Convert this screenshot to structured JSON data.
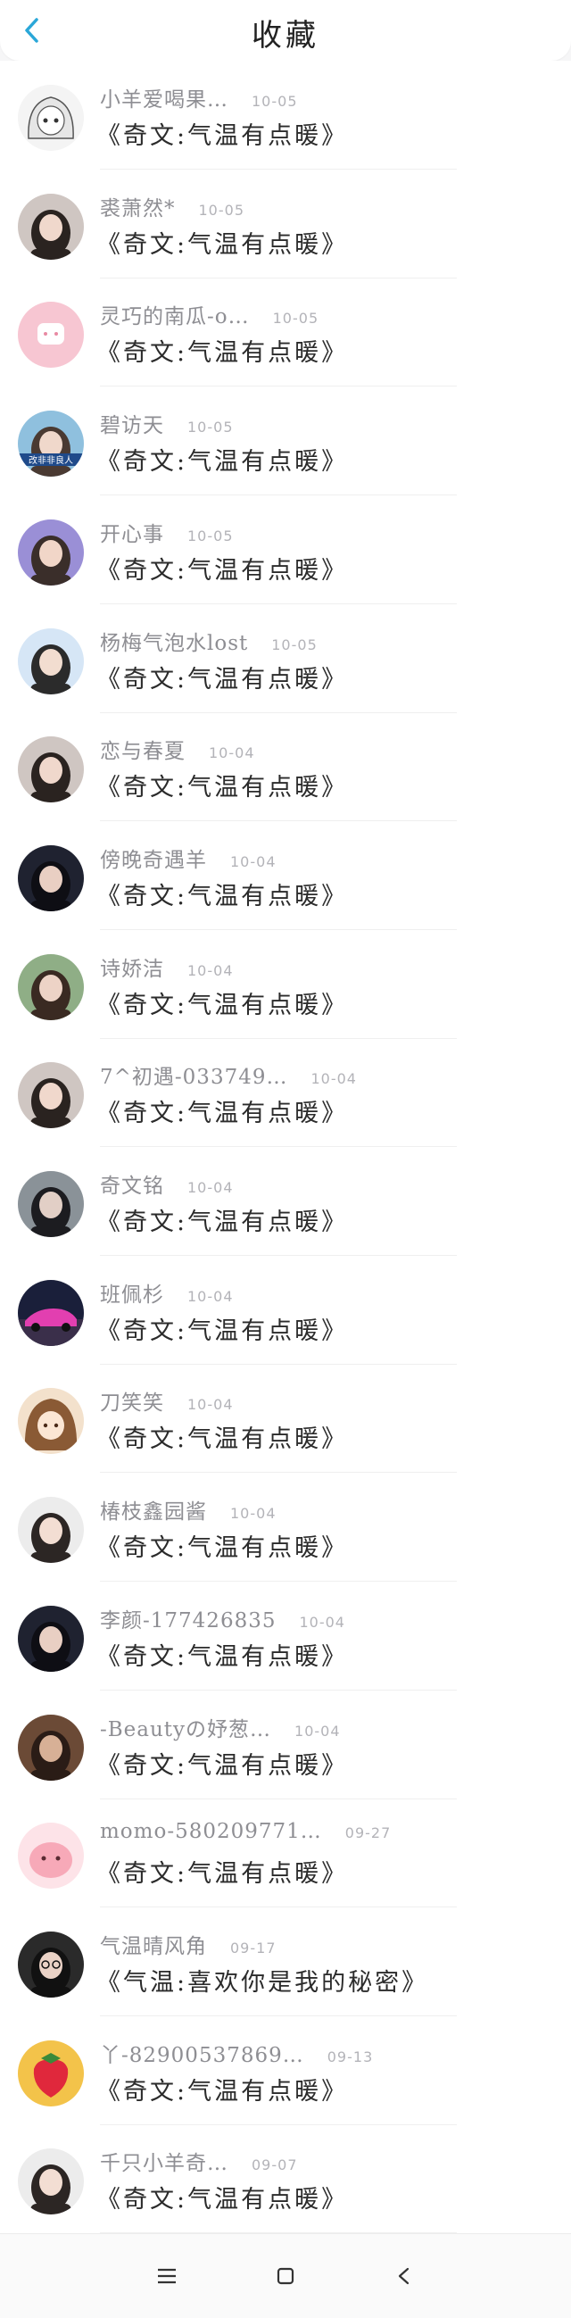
{
  "header": {
    "title": "收藏",
    "back_icon": "chevron-left-icon",
    "accent_color": "#2aa7d8"
  },
  "favorites": [
    {
      "name": "小羊爱喝果…",
      "date": "10-05",
      "message": "《奇文:气温有点暖》",
      "avatar": "anime-girl"
    },
    {
      "name": "裘萧然*",
      "date": "10-05",
      "message": "《奇文:气温有点暖》",
      "avatar": "photo-portrait"
    },
    {
      "name": "灵巧的南瓜-o…",
      "date": "10-05",
      "message": "《奇文:气温有点暖》",
      "avatar": "pink-cartoon"
    },
    {
      "name": "碧访天",
      "date": "10-05",
      "message": "《奇文:气温有点暖》",
      "avatar": "photo-caption",
      "avatar_text": "改非非良人"
    },
    {
      "name": "开心事",
      "date": "10-05",
      "message": "《奇文:气温有点暖》",
      "avatar": "photo-purple"
    },
    {
      "name": "杨梅气泡水lost",
      "date": "10-05",
      "message": "《奇文:气温有点暖》",
      "avatar": "photo-blue"
    },
    {
      "name": "恋与春夏",
      "date": "10-04",
      "message": "《奇文:气温有点暖》",
      "avatar": "photo-portrait"
    },
    {
      "name": "傍晚奇遇羊",
      "date": "10-04",
      "message": "《奇文:气温有点暖》",
      "avatar": "photo-dark"
    },
    {
      "name": "诗娇洁",
      "date": "10-04",
      "message": "《奇文:气温有点暖》",
      "avatar": "photo-green"
    },
    {
      "name": "7^初遇-033749…",
      "date": "10-04",
      "message": "《奇文:气温有点暖》",
      "avatar": "photo-portrait"
    },
    {
      "name": "奇文铭",
      "date": "10-04",
      "message": "《奇文:气温有点暖》",
      "avatar": "photo-grey"
    },
    {
      "name": "班佩杉",
      "date": "10-04",
      "message": "《奇文:气温有点暖》",
      "avatar": "pink-car"
    },
    {
      "name": "刀笑笑",
      "date": "10-04",
      "message": "《奇文:气温有点暖》",
      "avatar": "anime-brown"
    },
    {
      "name": "椿枝鑫园酱",
      "date": "10-04",
      "message": "《奇文:气温有点暖》",
      "avatar": "photo-light"
    },
    {
      "name": "李颜-177426835",
      "date": "10-04",
      "message": "《奇文:气温有点暖》",
      "avatar": "photo-dark"
    },
    {
      "name": "-Beautyの妤葱…",
      "date": "10-04",
      "message": "《奇文:气温有点暖》",
      "avatar": "photo-brown"
    },
    {
      "name": "momo-580209771…",
      "date": "09-27",
      "message": "《奇文:气温有点暖》",
      "avatar": "pink-blob"
    },
    {
      "name": "气温晴风角",
      "date": "09-17",
      "message": "《气温:喜欢你是我的秘密》",
      "avatar": "photo-glasses"
    },
    {
      "name": "丫-82900537869…",
      "date": "09-13",
      "message": "《奇文:气温有点暖》",
      "avatar": "strawberry"
    },
    {
      "name": "千只小羊奇…",
      "date": "09-07",
      "message": "《奇文:气温有点暖》",
      "avatar": "photo-light"
    }
  ],
  "navbar": {
    "menu_icon": "menu-icon",
    "home_icon": "home-square-icon",
    "back_icon": "back-triangle-icon"
  }
}
